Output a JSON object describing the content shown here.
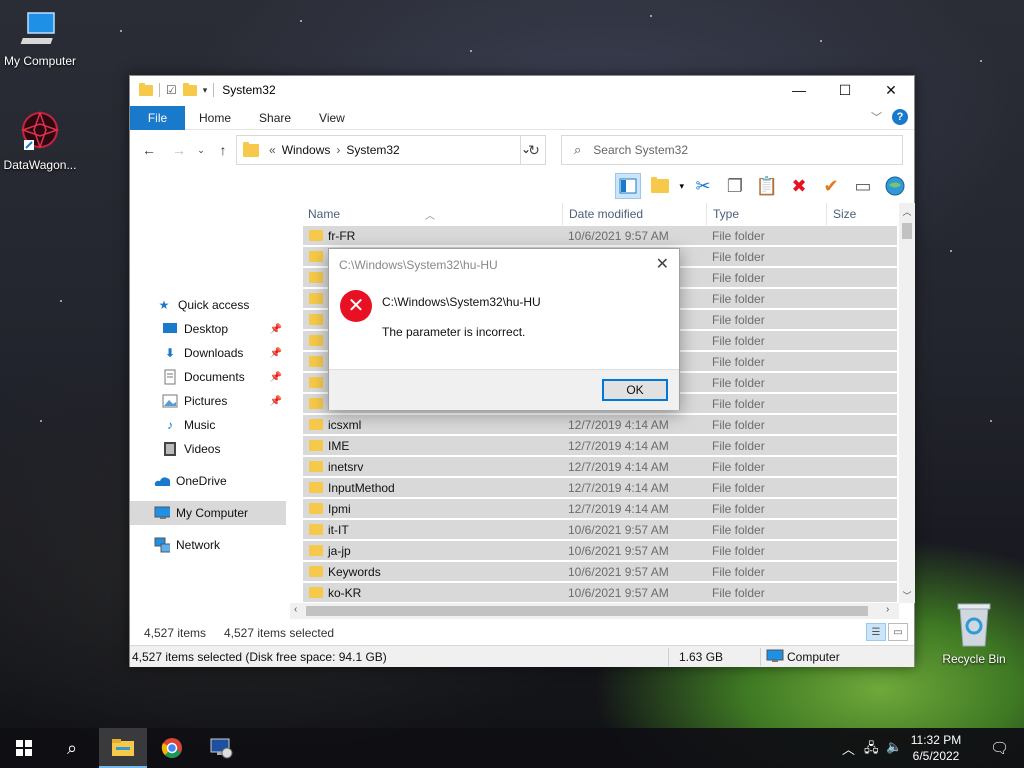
{
  "desktop": {
    "icons": [
      {
        "label": "My Computer",
        "icon": "computer-icon"
      },
      {
        "label": "DataWagon...",
        "icon": "datawagon-shortcut-icon"
      },
      {
        "label": "Recycle Bin",
        "icon": "recycle-bin-icon"
      }
    ]
  },
  "window": {
    "title": "System32",
    "controls": {
      "minimize": "—",
      "maximize": "☐",
      "close": "✕"
    },
    "ribbon_tabs": [
      "File",
      "Home",
      "Share",
      "View"
    ],
    "address": {
      "prefix": "«",
      "segments": [
        "Windows",
        "System32"
      ]
    },
    "search_placeholder": "Search System32",
    "nav_pane": [
      {
        "label": "Quick access",
        "icon": "star-icon"
      },
      {
        "label": "Desktop",
        "icon": "desktop-icon",
        "pinned": true
      },
      {
        "label": "Downloads",
        "icon": "download-icon",
        "pinned": true
      },
      {
        "label": "Documents",
        "icon": "documents-icon",
        "pinned": true
      },
      {
        "label": "Pictures",
        "icon": "pictures-icon",
        "pinned": true
      },
      {
        "label": "Music",
        "icon": "music-icon"
      },
      {
        "label": "Videos",
        "icon": "videos-icon"
      },
      {
        "label": "OneDrive",
        "icon": "onedrive-icon"
      },
      {
        "label": "My Computer",
        "icon": "computer-icon",
        "selected": true
      },
      {
        "label": "Network",
        "icon": "network-icon"
      }
    ],
    "columns": [
      "Name",
      "Date modified",
      "Type",
      "Size"
    ],
    "rows": [
      {
        "name": "fr-FR",
        "date": "10/6/2021 9:57 AM",
        "type": "File folder"
      },
      {
        "name": "",
        "date": "",
        "type": "File folder"
      },
      {
        "name": "",
        "date": "",
        "type": "File folder"
      },
      {
        "name": "",
        "date": "",
        "type": "File folder"
      },
      {
        "name": "",
        "date": "",
        "type": "File folder"
      },
      {
        "name": "",
        "date": "",
        "type": "File folder"
      },
      {
        "name": "",
        "date": "",
        "type": "File folder"
      },
      {
        "name": "",
        "date": "",
        "type": "File folder"
      },
      {
        "name": "",
        "date": "",
        "type": "File folder"
      },
      {
        "name": "icsxml",
        "date": "12/7/2019 4:14 AM",
        "type": "File folder"
      },
      {
        "name": "IME",
        "date": "12/7/2019 4:14 AM",
        "type": "File folder"
      },
      {
        "name": "inetsrv",
        "date": "12/7/2019 4:14 AM",
        "type": "File folder"
      },
      {
        "name": "InputMethod",
        "date": "12/7/2019 4:14 AM",
        "type": "File folder"
      },
      {
        "name": "Ipmi",
        "date": "12/7/2019 4:14 AM",
        "type": "File folder"
      },
      {
        "name": "it-IT",
        "date": "10/6/2021 9:57 AM",
        "type": "File folder"
      },
      {
        "name": "ja-jp",
        "date": "10/6/2021 9:57 AM",
        "type": "File folder"
      },
      {
        "name": "Keywords",
        "date": "10/6/2021 9:57 AM",
        "type": "File folder"
      },
      {
        "name": "ko-KR",
        "date": "10/6/2021 9:57 AM",
        "type": "File folder"
      }
    ],
    "status_inner": {
      "count": "4,527 items",
      "selected": "4,527 items selected"
    },
    "status_outer": {
      "selection": "4,527 items selected (Disk free space: 94.1 GB)",
      "size": "1.63 GB",
      "location": "Computer"
    }
  },
  "dialog": {
    "title": "C:\\Windows\\System32\\hu-HU",
    "path": "C:\\Windows\\System32\\hu-HU",
    "message": "The parameter is incorrect.",
    "ok_label": "OK"
  },
  "taskbar": {
    "time": "11:32 PM",
    "date": "6/5/2022",
    "apps": [
      "file-explorer-icon",
      "chrome-icon",
      "remote-desktop-icon"
    ]
  },
  "colors": {
    "accent": "#1979ca",
    "error": "#e81123",
    "folder": "#f6c94a",
    "selection_row": "#d9d9d9"
  }
}
